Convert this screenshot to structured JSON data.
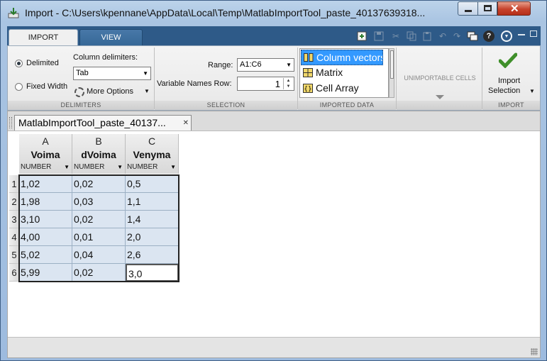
{
  "window": {
    "title": "Import - C:\\Users\\kpennane\\AppData\\Local\\Temp\\MatlabImportTool_paste_40137639318..."
  },
  "tabs": [
    {
      "label": "IMPORT",
      "selected": true
    },
    {
      "label": "VIEW",
      "selected": false
    }
  ],
  "quick_access_icons": [
    "import-data-icon",
    "save-icon",
    "cut-icon",
    "copy-icon",
    "paste-icon",
    "undo-icon",
    "redo-icon",
    "switch-windows-icon",
    "help-icon",
    "ribbon-menu-icon"
  ],
  "delimiters": {
    "options": [
      {
        "label": "Delimited",
        "selected": true
      },
      {
        "label": "Fixed Width",
        "selected": false
      }
    ],
    "column_delimiters_label": "Column delimiters:",
    "column_delimiter_value": "Tab",
    "more_options_label": "More Options",
    "section_label": "DELIMITERS"
  },
  "selection": {
    "range_label": "Range:",
    "range_value": "A1:C6",
    "variable_names_row_label": "Variable Names Row:",
    "variable_names_row_value": "1",
    "section_label": "SELECTION"
  },
  "imported_data": {
    "items": [
      {
        "label": "Column vectors",
        "selected": true,
        "icon": "column-vectors-icon"
      },
      {
        "label": "Matrix",
        "selected": false,
        "icon": "matrix-icon"
      },
      {
        "label": "Cell Array",
        "selected": false,
        "icon": "cell-array-icon"
      }
    ],
    "section_label": "IMPORTED DATA"
  },
  "unimportable": {
    "label": "UNIMPORTABLE CELLS"
  },
  "import": {
    "button_line1": "Import",
    "button_line2": "Selection",
    "section_label": "IMPORT"
  },
  "document": {
    "tab_label": "MatlabImportTool_paste_40137...",
    "columns": [
      {
        "letter": "A",
        "name": "Voima",
        "type": "NUMBER"
      },
      {
        "letter": "B",
        "name": "dVoima",
        "type": "NUMBER"
      },
      {
        "letter": "C",
        "name": "Venyma",
        "type": "NUMBER"
      }
    ],
    "rows": [
      {
        "num": "1",
        "cells": [
          "1,02",
          "0,02",
          "0,5"
        ]
      },
      {
        "num": "2",
        "cells": [
          "1,98",
          "0,03",
          "1,1"
        ]
      },
      {
        "num": "3",
        "cells": [
          "3,10",
          "0,02",
          "1,4"
        ]
      },
      {
        "num": "4",
        "cells": [
          "4,00",
          "0,01",
          "2,0"
        ]
      },
      {
        "num": "5",
        "cells": [
          "5,02",
          "0,04",
          "2,6"
        ]
      },
      {
        "num": "6",
        "cells": [
          "5,99",
          "0,02",
          "3,0"
        ]
      }
    ]
  }
}
